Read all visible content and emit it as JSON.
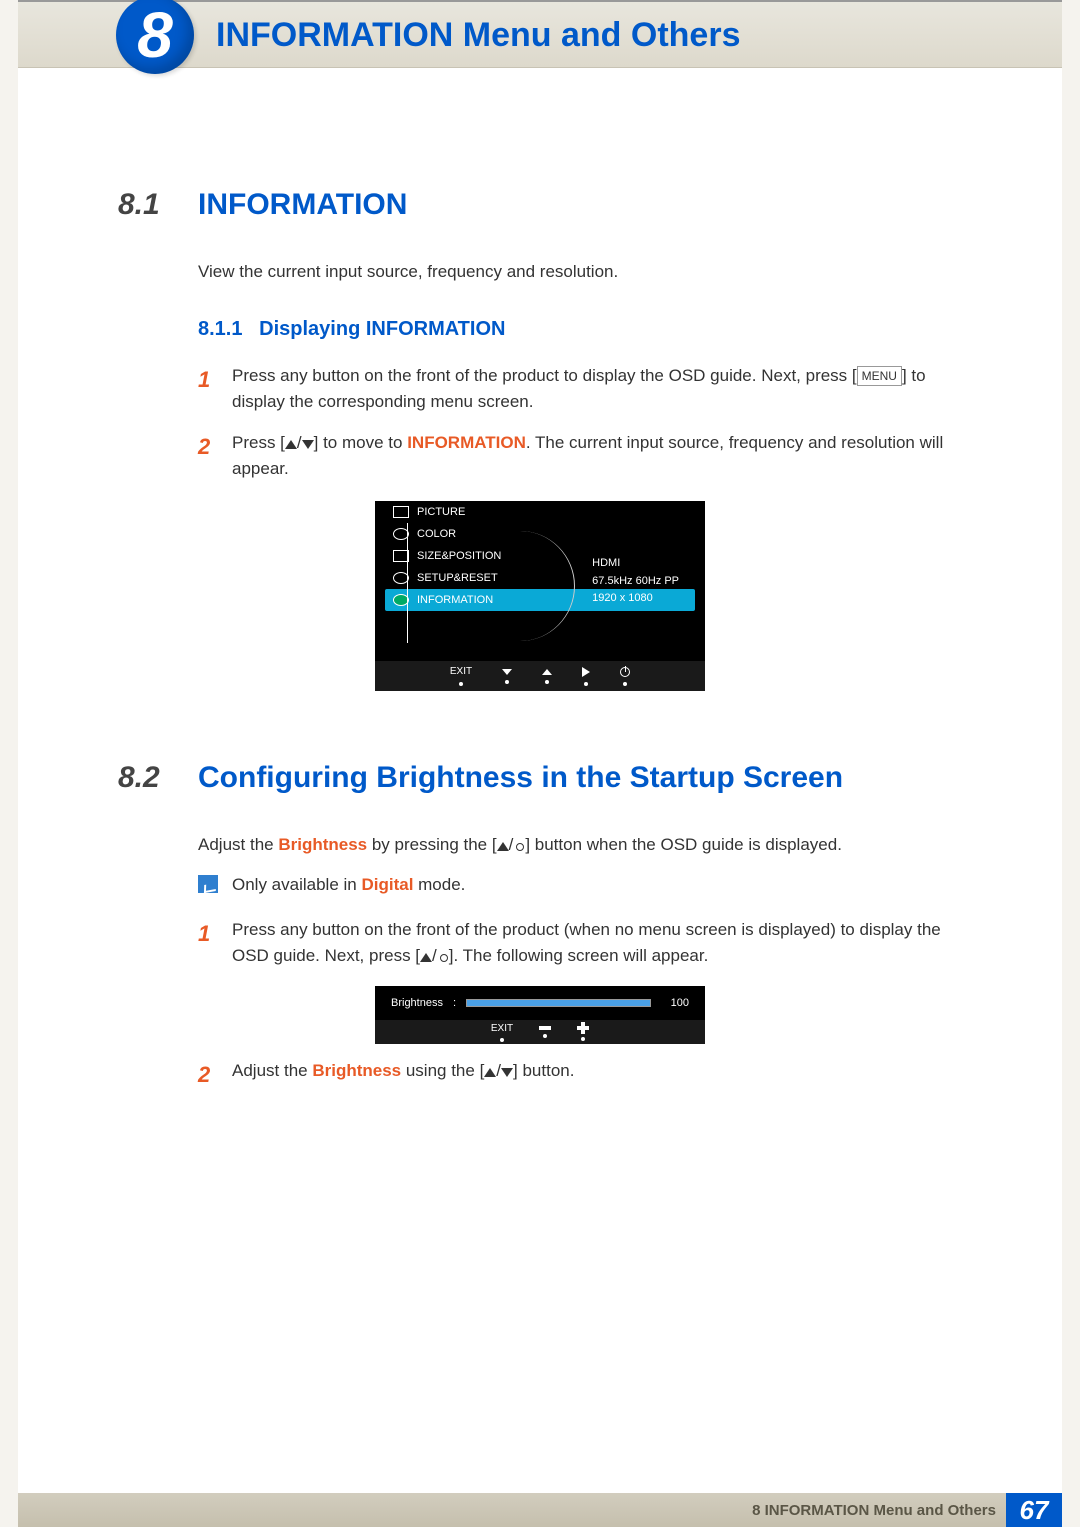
{
  "chapter": {
    "number": "8",
    "title": "INFORMATION Menu and Others"
  },
  "section1": {
    "number": "8.1",
    "title": "INFORMATION",
    "desc": "View the current input source, frequency and resolution.",
    "sub_number": "8.1.1",
    "sub_title": "Displaying INFORMATION",
    "step1_num": "1",
    "step1_a": "Press any button on the front of the product to display the OSD guide. Next, press [",
    "step1_key": "MENU",
    "step1_b": "] to display the corresponding menu screen.",
    "step2_num": "2",
    "step2_a": "Press [",
    "step2_b": "] to move to ",
    "step2_hl": "INFORMATION",
    "step2_c": ". The current input source, frequency and resolution will appear."
  },
  "osd1": {
    "items": [
      "PICTURE",
      "COLOR",
      "SIZE&POSITION",
      "SETUP&RESET",
      "INFORMATION"
    ],
    "info_source": "HDMI",
    "info_freq": "67.5kHz 60Hz PP",
    "info_res": "1920 x 1080",
    "exit": "EXIT"
  },
  "section2": {
    "number": "8.2",
    "title": "Configuring Brightness in the Startup Screen",
    "desc_a": "Adjust the ",
    "desc_hl": "Brightness",
    "desc_b": " by pressing the [",
    "desc_c": "] button when the OSD guide is displayed.",
    "note_a": "Only available in ",
    "note_hl": "Digital",
    "note_b": " mode.",
    "step1_num": "1",
    "step1_a": "Press any button on the front of the product (when no menu screen is displayed) to display the OSD guide. Next, press [",
    "step1_b": "]. The following screen will appear.",
    "step2_num": "2",
    "step2_a": "Adjust the ",
    "step2_hl": "Brightness",
    "step2_b": " using the [",
    "step2_c": "] button."
  },
  "osd2": {
    "label": "Brightness",
    "colon": ":",
    "value": "100",
    "exit": "EXIT"
  },
  "footer": {
    "text": "8 INFORMATION Menu and Others",
    "page": "67"
  }
}
